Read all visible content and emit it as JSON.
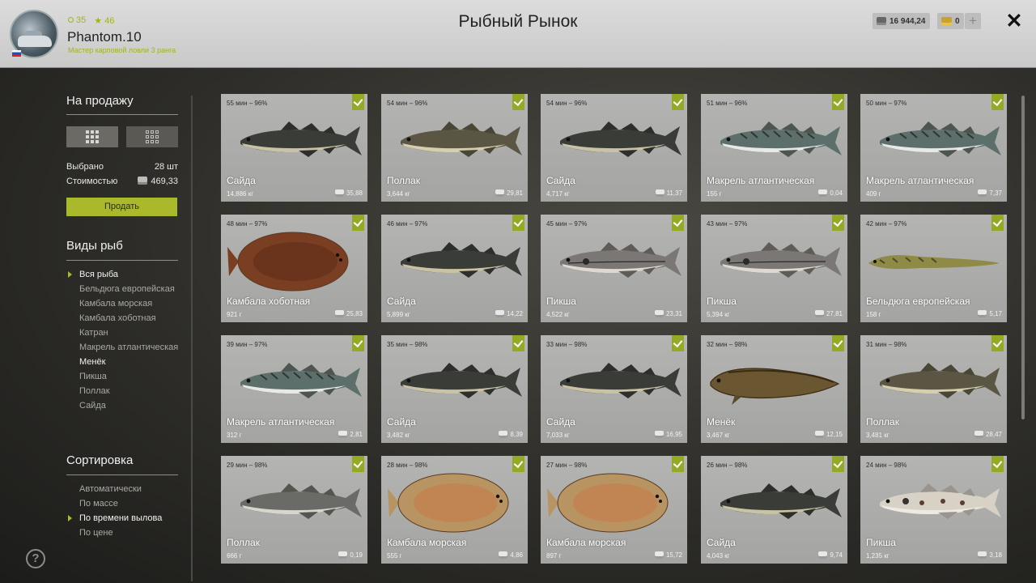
{
  "header": {
    "level": "35",
    "stars": "46",
    "player_name": "Phantom.10",
    "player_title": "Мастер карповой ловли 3 ранга",
    "page_title": "Рыбный Рынок",
    "silver": "16 944,24",
    "gold": "0",
    "plus": "+",
    "close": "✕"
  },
  "sidebar": {
    "for_sale_title": "На продажу",
    "selected_label": "Выбрано",
    "selected_value": "28 шт",
    "cost_label": "Стоимостью",
    "cost_value": "469,33",
    "sell_button": "Продать",
    "species_title": "Виды рыб",
    "species": [
      {
        "label": "Вся рыба",
        "state": "active"
      },
      {
        "label": "Бельдюга европейская",
        "state": ""
      },
      {
        "label": "Камбала морская",
        "state": ""
      },
      {
        "label": "Камбала хоботная",
        "state": ""
      },
      {
        "label": "Катран",
        "state": ""
      },
      {
        "label": "Макрель атлантическая",
        "state": ""
      },
      {
        "label": "Менёк",
        "state": "current"
      },
      {
        "label": "Пикша",
        "state": ""
      },
      {
        "label": "Поллак",
        "state": ""
      },
      {
        "label": "Сайда",
        "state": ""
      }
    ],
    "sort_title": "Сортировка",
    "sort": [
      {
        "label": "Автоматически",
        "state": ""
      },
      {
        "label": "По массе",
        "state": ""
      },
      {
        "label": "По времени вылова",
        "state": "active"
      },
      {
        "label": "По цене",
        "state": ""
      }
    ],
    "help": "?"
  },
  "colors": {
    "accent": "#a9b92b",
    "card_bg": "#acacaa",
    "header_bg": "#d2d2d2"
  },
  "cards": [
    {
      "time": "55 мин – 96%",
      "name": "Сайда",
      "weight": "14,886 кг",
      "price": "35,88",
      "kind": "saithe"
    },
    {
      "time": "54 мин – 96%",
      "name": "Поллак",
      "weight": "3,644 кг",
      "price": "29,81",
      "kind": "pollack"
    },
    {
      "time": "54 мин – 96%",
      "name": "Сайда",
      "weight": "4,717 кг",
      "price": "11,37",
      "kind": "saithe"
    },
    {
      "time": "51 мин – 96%",
      "name": "Макрель атлантическая",
      "weight": "155 г",
      "price": "0,04",
      "kind": "mackerel"
    },
    {
      "time": "50 мин – 97%",
      "name": "Макрель атлантическая",
      "weight": "409 г",
      "price": "7,37",
      "kind": "mackerel"
    },
    {
      "time": "48 мин – 97%",
      "name": "Камбала хоботная",
      "weight": "921 г",
      "price": "25,83",
      "kind": "flounder-dark"
    },
    {
      "time": "46 мин – 97%",
      "name": "Сайда",
      "weight": "5,899 кг",
      "price": "14,22",
      "kind": "saithe"
    },
    {
      "time": "45 мин – 97%",
      "name": "Пикша",
      "weight": "4,522 кг",
      "price": "23,31",
      "kind": "haddock"
    },
    {
      "time": "43 мин – 97%",
      "name": "Пикша",
      "weight": "5,394 кг",
      "price": "27,81",
      "kind": "haddock"
    },
    {
      "time": "42 мин – 97%",
      "name": "Бельдюга европейская",
      "weight": "158 г",
      "price": "5,17",
      "kind": "eelpout"
    },
    {
      "time": "39 мин – 97%",
      "name": "Макрель атлантическая",
      "weight": "312 г",
      "price": "2,81",
      "kind": "mackerel"
    },
    {
      "time": "35 мин – 98%",
      "name": "Сайда",
      "weight": "3,482 кг",
      "price": "8,39",
      "kind": "saithe"
    },
    {
      "time": "33 мин – 98%",
      "name": "Сайда",
      "weight": "7,033 кг",
      "price": "16,95",
      "kind": "saithe"
    },
    {
      "time": "32 мин – 98%",
      "name": "Менёк",
      "weight": "3,467 кг",
      "price": "12,15",
      "kind": "tusk"
    },
    {
      "time": "31 мин – 98%",
      "name": "Поллак",
      "weight": "3,481 кг",
      "price": "28,47",
      "kind": "pollack"
    },
    {
      "time": "29 мин – 98%",
      "name": "Поллак",
      "weight": "666 г",
      "price": "0,19",
      "kind": "pollack-light"
    },
    {
      "time": "28 мин – 98%",
      "name": "Камбала морская",
      "weight": "555 г",
      "price": "4,86",
      "kind": "plaice"
    },
    {
      "time": "27 мин – 98%",
      "name": "Камбала морская",
      "weight": "897 г",
      "price": "15,72",
      "kind": "plaice"
    },
    {
      "time": "26 мин – 98%",
      "name": "Сайда",
      "weight": "4,043 кг",
      "price": "9,74",
      "kind": "saithe"
    },
    {
      "time": "24 мин – 98%",
      "name": "Пикша",
      "weight": "1,235 кг",
      "price": "3,18",
      "kind": "haddock-spotted"
    }
  ]
}
